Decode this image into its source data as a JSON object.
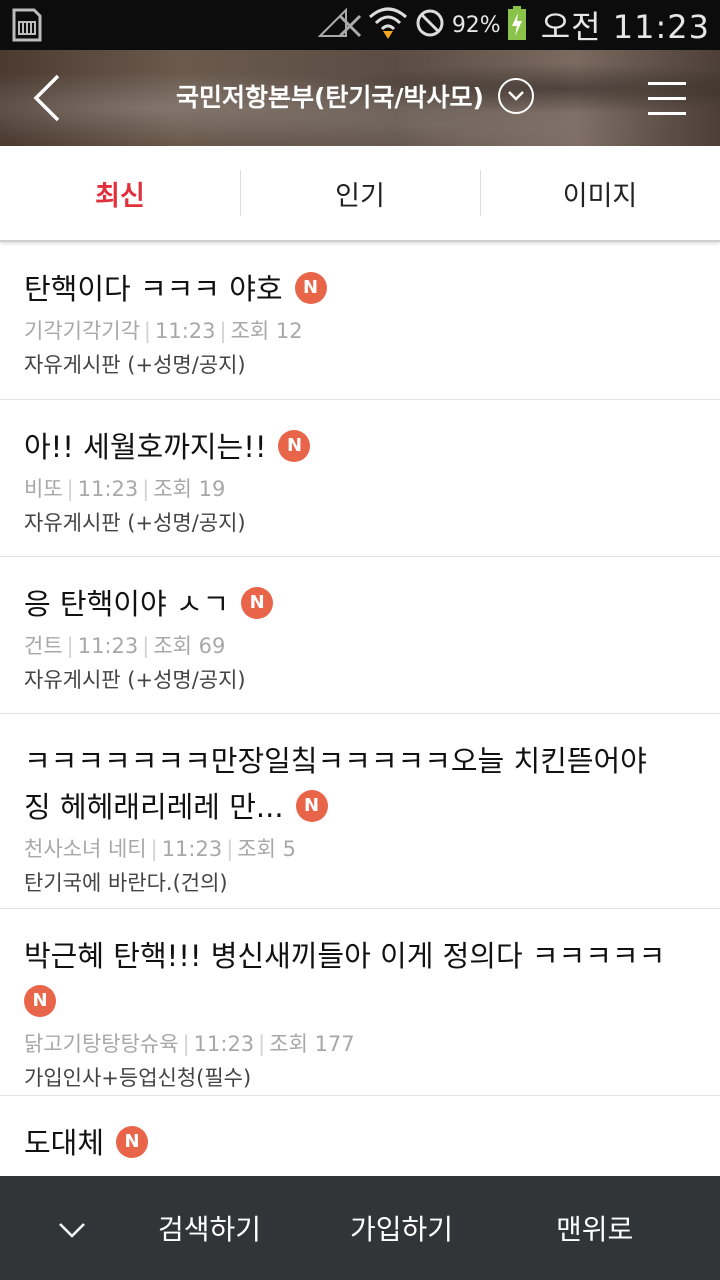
{
  "status_bar": {
    "battery_percent": "92%",
    "time": "오전 11:23",
    "icons": [
      "sim-card-icon",
      "no-signal-icon",
      "wifi-icon",
      "do-not-disturb-icon",
      "battery-charging-icon"
    ]
  },
  "header": {
    "title": "국민저항본부(탄기국/박사모)",
    "back_icon": "back-arrow-icon",
    "dropdown_icon": "chevron-down-circle-icon",
    "menu_icon": "hamburger-menu-icon"
  },
  "tabs": [
    {
      "label": "최신",
      "active": true
    },
    {
      "label": "인기",
      "active": false
    },
    {
      "label": "이미지",
      "active": false
    }
  ],
  "posts": [
    {
      "title": "탄핵이다 ㅋㅋㅋ 야호",
      "author": "기각기각기각",
      "time": "11:23",
      "views": "조회 12",
      "board": "자유게시판 (+성명/공지)",
      "badge": "N"
    },
    {
      "title": "아!! 세월호까지는!!",
      "author": "비또",
      "time": "11:23",
      "views": "조회 19",
      "board": "자유게시판 (+성명/공지)",
      "badge": "N"
    },
    {
      "title": "응 탄핵이야 ㅅㄱ",
      "author": "건트",
      "time": "11:23",
      "views": "조회 69",
      "board": "자유게시판 (+성명/공지)",
      "badge": "N"
    },
    {
      "title": "ㅋㅋㅋㅋㅋㅋㅋ만장일칰ㅋㅋㅋㅋㅋ오늘 치킨뜯어야징 헤헤래리레레 만...",
      "author": "천사소녀 네티",
      "time": "11:23",
      "views": "조회 5",
      "board": "탄기국에 바란다.(건의)",
      "badge": "N"
    },
    {
      "title": "박근혜 탄핵!!! 병신새끼들아 이게 정의다 ㅋㅋㅋㅋㅋ",
      "author": "닭고기탕탕탕슈육",
      "time": "11:23",
      "views": "조회 177",
      "board": "가입인사+등업신청(필수)",
      "badge": "N"
    },
    {
      "title": "도대체",
      "author": "",
      "time": "",
      "views": "",
      "board": "",
      "badge": "N"
    }
  ],
  "bottom_bar": {
    "collapse_icon": "chevron-down-icon",
    "search_label": "검색하기",
    "join_label": "가입하기",
    "top_label": "맨위로"
  }
}
